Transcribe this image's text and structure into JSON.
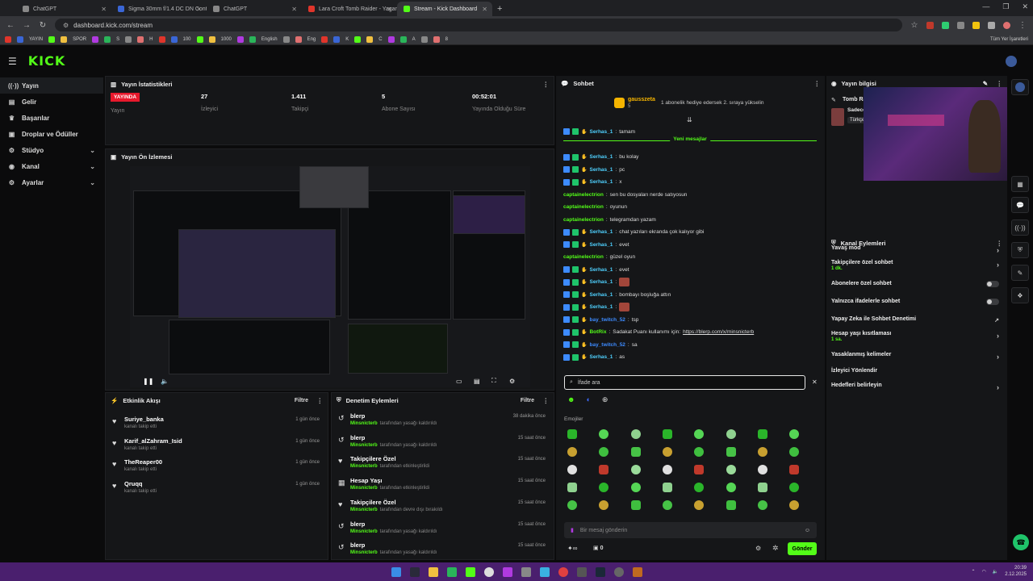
{
  "browser": {
    "tabs": [
      {
        "title": "ChatGPT",
        "color": "#888888"
      },
      {
        "title": "Sigma 30mm f/1.4 DC DN Cont...",
        "color": "#3a66d6"
      },
      {
        "title": "ChatGPT",
        "color": "#888888"
      },
      {
        "title": "Lara Croft Tomb Raider - Yagan...",
        "color": "#e0352b"
      },
      {
        "title": "Stream - Kick Dashboard",
        "color": "#53fc18"
      }
    ],
    "url": "dashboard.kick.com/stream",
    "bookmarks": [
      "YAYIN",
      "SPOR",
      "S",
      "H",
      "100",
      "1000",
      "English",
      "Eng",
      "K",
      "C",
      "A",
      "8"
    ],
    "all_bookmarks": "Tüm Yer İşaretleri"
  },
  "kick": {
    "logo": "KICK",
    "sidebar": [
      {
        "icon": "((·))",
        "label": "Yayın",
        "chev": ""
      },
      {
        "icon": "▤",
        "label": "Gelir",
        "chev": ""
      },
      {
        "icon": "♛",
        "label": "Başarılar",
        "chev": ""
      },
      {
        "icon": "▣",
        "label": "Droplar ve Ödüller",
        "chev": ""
      },
      {
        "icon": "⚙",
        "label": "Stüdyo",
        "chev": "⌄"
      },
      {
        "icon": "◉",
        "label": "Kanal",
        "chev": "⌄"
      },
      {
        "icon": "⚙",
        "label": "Ayarlar",
        "chev": "⌄"
      }
    ],
    "stats": {
      "title": "Yayın İstatistikleri",
      "live": "YAYINDA",
      "items": [
        {
          "value": "",
          "label": "Yayın"
        },
        {
          "value": "27",
          "label": "İzleyici"
        },
        {
          "value": "1.411",
          "label": "Takipçi"
        },
        {
          "value": "5",
          "label": "Abone Sayısı"
        },
        {
          "value": "00:52:01",
          "label": "Yayında Olduğu Süre"
        }
      ]
    },
    "preview_title": "Yayın Ön İzlemesi",
    "activity": {
      "title": "Etkinlik Akışı",
      "filter": "Filtre",
      "items": [
        {
          "name": "Suriye_banka",
          "sub": "kanalı takip etti",
          "time": "1 gün önce"
        },
        {
          "name": "Karif_alZahram_Isid",
          "sub": "kanalı takip etti",
          "time": "1 gün önce"
        },
        {
          "name": "TheReaper00",
          "sub": "kanalı takip etti",
          "time": "1 gün önce"
        },
        {
          "name": "Qruqq",
          "sub": "kanalı takip etti",
          "time": "1 gün önce"
        }
      ]
    },
    "moderation": {
      "title": "Denetim Eylemleri",
      "filter": "Filtre",
      "items": [
        {
          "name": "blerp",
          "mod": "Minsnicterb",
          "sub": "tarafından yasağı kaldırıldı",
          "time": "38 dakika önce"
        },
        {
          "name": "blerp",
          "mod": "Minsnicterb",
          "sub": "tarafından yasağı kaldırıldı",
          "time": "15 saat önce"
        },
        {
          "name": "Takipçilere Özel",
          "mod": "Minsnicterb",
          "sub": "tarafından etkinleştirildi",
          "time": "15 saat önce"
        },
        {
          "name": "Hesap Yaşı",
          "mod": "Minsnicterb",
          "sub": "tarafından etkinleştirildi",
          "time": "15 saat önce"
        },
        {
          "name": "Takipçilere Özel",
          "mod": "Minsnicterb",
          "sub": "tarafından devre dışı bırakıldı",
          "time": "15 saat önce"
        },
        {
          "name": "blerp",
          "mod": "Minsnicterb",
          "sub": "tarafından yasağı kaldırıldı",
          "time": "15 saat önce"
        },
        {
          "name": "blerp",
          "mod": "Minsnicterb",
          "sub": "tarafından yasağı kaldırıldı",
          "time": "15 saat önce"
        }
      ]
    },
    "chat": {
      "title": "Sohbet",
      "pinned_user": "gausszeta",
      "pinned_count": "5",
      "pinned_text": "1 abonelik hediye edersek 2. sıraya yükselin",
      "new_messages": "Yeni mesajlar",
      "messages": [
        {
          "user": "Serhas_1",
          "color": "#4fd1ff",
          "text": "tamam",
          "badges": true,
          "img": false
        },
        {
          "user": "Serhas_1",
          "color": "#4fd1ff",
          "text": "bu kolay",
          "badges": true,
          "img": false
        },
        {
          "user": "Serhas_1",
          "color": "#4fd1ff",
          "text": "pc",
          "badges": true,
          "img": false
        },
        {
          "user": "Serhas_1",
          "color": "#4fd1ff",
          "text": "x",
          "badges": true,
          "img": false
        },
        {
          "user": "captainelectrion",
          "color": "#53fc18",
          "text": "sen bu dosyaları nerde satıyosun",
          "badges": false,
          "img": false
        },
        {
          "user": "captainelectrion",
          "color": "#53fc18",
          "text": "oyunun",
          "badges": false,
          "img": false
        },
        {
          "user": "captainelectrion",
          "color": "#53fc18",
          "text": "telegramdan yazam",
          "badges": false,
          "img": false
        },
        {
          "user": "Serhas_1",
          "color": "#4fd1ff",
          "text": "chat yazıları ekranda çok kalıyor gibi",
          "badges": true,
          "img": false
        },
        {
          "user": "Serhas_1",
          "color": "#4fd1ff",
          "text": "evet",
          "badges": true,
          "img": false
        },
        {
          "user": "captainelectrion",
          "color": "#53fc18",
          "text": "güzel oyun",
          "badges": false,
          "img": false
        },
        {
          "user": "Serhas_1",
          "color": "#4fd1ff",
          "text": "evet",
          "badges": true,
          "img": false
        },
        {
          "user": "Serhas_1",
          "color": "#4fd1ff",
          "text": "",
          "badges": true,
          "img": true
        },
        {
          "user": "Serhas_1",
          "color": "#4fd1ff",
          "text": "bombayı boşluğa attın",
          "badges": true,
          "img": false
        },
        {
          "user": "Serhas_1",
          "color": "#4fd1ff",
          "text": "",
          "badges": true,
          "img": true
        },
        {
          "user": "bay_twitch_52",
          "color": "#3d8bff",
          "text": "tsp",
          "badges": true,
          "img": false
        },
        {
          "user": "BotRix",
          "color": "#53fc18",
          "text": "Sadakat Puanı kullanımı için:",
          "link": "https://blerp.com/x/minsnicterb",
          "badges": true,
          "img": false
        },
        {
          "user": "bay_twitch_52",
          "color": "#3d8bff",
          "text": "sa",
          "badges": true,
          "img": false
        },
        {
          "user": "Serhas_1",
          "color": "#4fd1ff",
          "text": "as",
          "badges": true,
          "img": false
        }
      ],
      "search_placeholder": "İfade ara",
      "emotes_label": "Emojiler",
      "input_placeholder": "Bir mesaj gönderin",
      "counter": "0",
      "send": "Gönder"
    },
    "info": {
      "title": "Yayın bilgisi",
      "stream_title": "Tomb Raider",
      "snippet": "Sadece",
      "tag": "Türkçe"
    },
    "channel": {
      "title": "Kanal Eylemleri",
      "items": [
        {
          "label": "Yavaş mod",
          "sub": "",
          "control": "arrow"
        },
        {
          "label": "Takipçilere özel sohbet",
          "sub": "1 dk.",
          "control": "arrow"
        },
        {
          "label": "Abonelere özel sohbet",
          "sub": "",
          "control": "toggle"
        },
        {
          "label": "Yalnızca ifadelerle sohbet",
          "sub": "",
          "control": "toggle"
        },
        {
          "label": "Yapay Zeka ile Sohbet Denetimi",
          "sub": "",
          "control": "ext"
        },
        {
          "label": "Hesap yaşı kısıtlaması",
          "sub": "1 sa.",
          "control": "arrow"
        },
        {
          "label": "Yasaklanmış kelimeler",
          "sub": "",
          "control": "arrow"
        },
        {
          "label": "İzleyici Yönlendir",
          "sub": "",
          "control": "none"
        },
        {
          "label": "Hedefleri belirleyin",
          "sub": "",
          "control": "arrow"
        }
      ]
    }
  },
  "taskbar": {
    "time": "20:39",
    "date": "2.12.2025"
  },
  "colors": {
    "accent": "#53fc18",
    "live": "#e8192c",
    "taskbar": "#4a1f6e"
  }
}
